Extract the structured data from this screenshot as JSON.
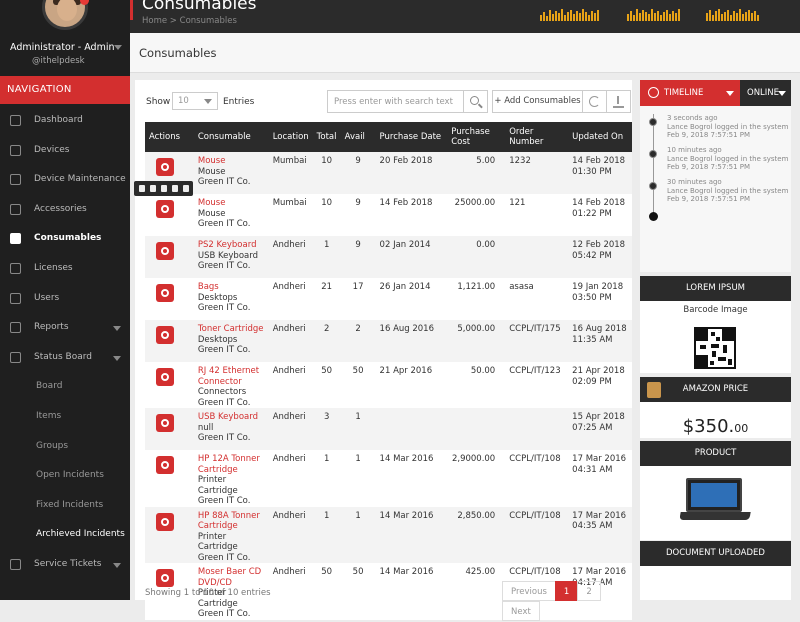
{
  "sidebar": {
    "user_name": "Administrator - Admin",
    "user_handle": "@ithelpdesk",
    "nav_heading": "NAVIGATION",
    "items": [
      {
        "label": "Dashboard",
        "icon": "home-icon"
      },
      {
        "label": "Devices",
        "icon": "inbox-icon"
      },
      {
        "label": "Device Maintenance",
        "icon": "database-icon"
      },
      {
        "label": "Accessories",
        "icon": "paperclip-icon"
      },
      {
        "label": "Consumables",
        "icon": "columns-icon",
        "active": true
      },
      {
        "label": "Licenses",
        "icon": "bookmark-icon"
      },
      {
        "label": "Users",
        "icon": "users-icon"
      },
      {
        "label": "Reports",
        "icon": "chart-icon"
      },
      {
        "label": "Status Board",
        "icon": "pie-icon"
      },
      {
        "label": "Board",
        "sub": true
      },
      {
        "label": "Items",
        "sub": true
      },
      {
        "label": "Groups",
        "sub": true
      },
      {
        "label": "Open Incidents",
        "sub": true
      },
      {
        "label": "Fixed Incidents",
        "sub": true
      },
      {
        "label": "Archieved Incidents",
        "sub": true,
        "active": true
      },
      {
        "label": "Service Tickets",
        "icon": "tag-icon"
      }
    ]
  },
  "header": {
    "title": "Consumables",
    "breadcrumb": "Home > Consumables"
  },
  "section": {
    "title": "Consumables"
  },
  "controls": {
    "show_label": "Show",
    "page_size": "10",
    "entries_label": "Entries",
    "search_placeholder": "Press enter with search text",
    "add_button": "+ Add Consumables"
  },
  "table": {
    "columns": [
      "Actions",
      "Consumable",
      "Location",
      "Total",
      "Avail",
      "Purchase Date",
      "Purchase Cost",
      "Order Number",
      "Updated On"
    ],
    "rows": [
      {
        "name": "Mouse",
        "type": "Mouse",
        "vendor": "Green IT Co.",
        "location": "Mumbai",
        "total": "10",
        "avail": "9",
        "date": "20 Feb 2018",
        "cost": "5.00",
        "order": "1232",
        "updated": "14 Feb 2018",
        "time": "01:30 PM"
      },
      {
        "name": "Mouse",
        "type": "Mouse",
        "vendor": "Green IT Co.",
        "location": "Mumbai",
        "total": "10",
        "avail": "9",
        "date": "14 Feb 2018",
        "cost": "25000.00",
        "order": "121",
        "updated": "14 Feb 2018",
        "time": "01:22 PM"
      },
      {
        "name": "PS2 Keyboard",
        "type": "USB Keyboard",
        "vendor": "Green IT Co.",
        "location": "Andheri",
        "total": "1",
        "avail": "9",
        "date": "02 Jan 2014",
        "cost": "0.00",
        "order": "",
        "updated": "12 Feb 2018",
        "time": "05:42 PM"
      },
      {
        "name": "Bags",
        "type": "Desktops",
        "vendor": "Green IT Co.",
        "location": "Andheri",
        "total": "21",
        "avail": "17",
        "date": "26 Jan 2014",
        "cost": "1,121.00",
        "order": "asasa",
        "updated": "19 Jan 2018",
        "time": "03:50 PM"
      },
      {
        "name": "Toner Cartridge",
        "type": "Desktops",
        "vendor": "Green IT Co.",
        "location": "Andheri",
        "total": "2",
        "avail": "2",
        "date": "16 Aug 2016",
        "cost": "5,000.00",
        "order": "CCPL/IT/175",
        "updated": "16 Aug 2018",
        "time": "11:35 AM"
      },
      {
        "name": "RJ 42 Ethernet Connector",
        "type": "Connectors",
        "vendor": "Green IT Co.",
        "location": "Andheri",
        "total": "50",
        "avail": "50",
        "date": "21 Apr 2016",
        "cost": "50.00",
        "order": "CCPL/IT/123",
        "updated": "21 Apr 2018",
        "time": "02:09 PM"
      },
      {
        "name": "USB Keyboard",
        "type": "null",
        "vendor": "Green IT Co.",
        "location": "Andheri",
        "total": "3",
        "avail": "1",
        "date": "",
        "cost": "",
        "order": "",
        "updated": "15 Apr 2018",
        "time": "07:25 AM"
      },
      {
        "name": "HP 12A Tonner Cartridge",
        "type": "Printer Cartridge",
        "vendor": "Green IT Co.",
        "location": "Andheri",
        "total": "1",
        "avail": "1",
        "date": "14 Mar 2016",
        "cost": "2,9000.00",
        "order": "CCPL/IT/108",
        "updated": "17 Mar 2016",
        "time": "04:31 AM"
      },
      {
        "name": "HP 88A Tonner Cartridge",
        "type": "Printer Cartridge",
        "vendor": "Green IT Co.",
        "location": "Andheri",
        "total": "1",
        "avail": "1",
        "date": "14 Mar 2016",
        "cost": "2,850.00",
        "order": "CCPL/IT/108",
        "updated": "17 Mar 2016",
        "time": "04:35 AM"
      },
      {
        "name": "Moser Baer CD DVD/CD",
        "type": "Printer Cartridge",
        "vendor": "Green IT Co.",
        "location": "Andheri",
        "total": "50",
        "avail": "50",
        "date": "14 Mar 2016",
        "cost": "425.00",
        "order": "CCPL/IT/108",
        "updated": "17 Mar 2016",
        "time": "04:17 AM"
      }
    ]
  },
  "footer": {
    "info": "Showing 1 to 10 of 10 entries",
    "pager": [
      "Previous",
      "1",
      "2",
      "Next"
    ]
  },
  "right_panel": {
    "timeline_tab": "TIMELINE",
    "online_tab": "ONLINE",
    "timeline": [
      {
        "ago": "3 seconds ago",
        "text": "Lance Bogrol logged in the system",
        "date": "Feb 9, 2018 7:57:51 PM"
      },
      {
        "ago": "10 minutes ago",
        "text": "Lance Bogrol logged in the system",
        "date": "Feb 9, 2018 7:57:51 PM"
      },
      {
        "ago": "30 minutes ago",
        "text": "Lance Bogrol logged in the system",
        "date": "Feb 9, 2018 7:57:51 PM"
      }
    ],
    "lorem_title": "LOREM IPSUM",
    "barcode_label": "Barcode Image",
    "amazon_title": "AMAZON PRICE",
    "price_main": "$350.",
    "price_cents": "00",
    "product_title": "PRODUCT",
    "document_title": "DOCUMENT UPLOADED"
  },
  "colors": {
    "accent": "#d32f2f",
    "dark": "#2b2b2b",
    "bars": "#e8a317"
  }
}
